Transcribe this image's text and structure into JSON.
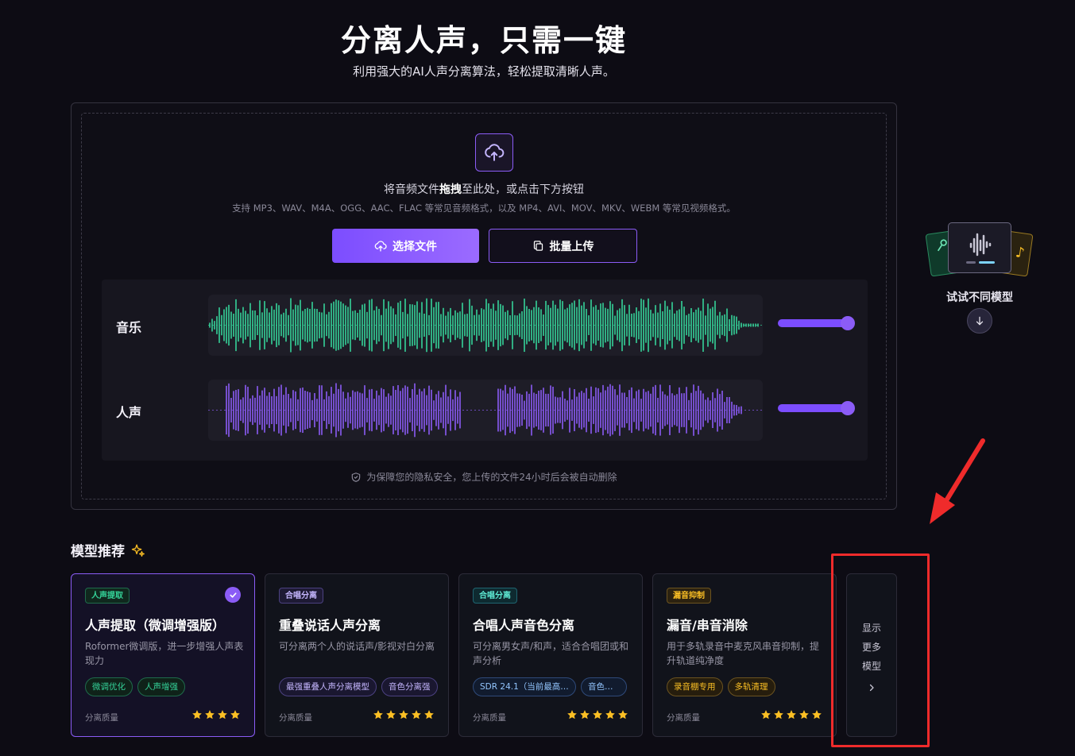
{
  "hero": {
    "title": "分离人声，只需一键",
    "subtitle": "利用强大的AI人声分离算法，轻松提取清晰人声。"
  },
  "upload": {
    "drag_text_before": "将音频文件",
    "drag_text_bold": "拖拽",
    "drag_text_after": "至此处，或点击下方按钮",
    "formats": "支持 MP3、WAV、M4A、OGG、AAC、FLAC 等常见音频格式，以及 MP4、AVI、MOV、MKV、WEBM 等常见视频格式。",
    "choose_file_label": "选择文件",
    "batch_upload_label": "批量上传",
    "privacy_text": "为保障您的隐私安全，您上传的文件24小时后会被自动删除",
    "tracks": [
      {
        "label": "音乐",
        "color": "#34d399",
        "volume": 1.0
      },
      {
        "label": "人声",
        "color": "#8b5cf6",
        "volume": 1.0
      }
    ]
  },
  "try_widget": {
    "label": "试试不同模型"
  },
  "models": {
    "section_title": "模型推荐",
    "cards": [
      {
        "tag": "人声提取",
        "tag_style": "green",
        "selected": true,
        "title": "人声提取（微调增强版）",
        "description": "Roformer微调版，进一步增强人声表现力",
        "chips": [
          {
            "label": "微调优化",
            "style": "green"
          },
          {
            "label": "人声增强",
            "style": "green"
          }
        ],
        "quality_label": "分离质量",
        "stars": 4
      },
      {
        "tag": "合唱分离",
        "tag_style": "purple",
        "selected": false,
        "title": "重叠说话人声分离",
        "description": "可分离两个人的说话声/影视对白分离",
        "chips": [
          {
            "label": "最强重叠人声分离模型",
            "style": "purple"
          },
          {
            "label": "音色分离强",
            "style": "purple"
          }
        ],
        "quality_label": "分离质量",
        "stars": 5
      },
      {
        "tag": "合唱分离",
        "tag_style": "teal",
        "selected": false,
        "title": "合唱人声音色分离",
        "description": "可分离男女声/和声，适合合唱团或和声分析",
        "chips": [
          {
            "label": "SDR 24.1（当前最高之...",
            "style": "blue"
          },
          {
            "label": "音色分...",
            "style": "blue"
          }
        ],
        "quality_label": "分离质量",
        "stars": 5
      },
      {
        "tag": "漏音抑制",
        "tag_style": "amber",
        "selected": false,
        "title": "漏音/串音消除",
        "description": "用于多轨录音中麦克风串音抑制，提升轨道纯净度",
        "chips": [
          {
            "label": "录音棚专用",
            "style": "amber"
          },
          {
            "label": "多轨清理",
            "style": "amber"
          }
        ],
        "quality_label": "分离质量",
        "stars": 5
      }
    ],
    "more": {
      "line1": "显示",
      "line2": "更多",
      "line3": "模型"
    }
  },
  "colors": {
    "accent": "#8b5cf6",
    "music_wave": "#34d399",
    "vocal_wave": "#8b5cf6",
    "star": "#fbbf24",
    "highlight": "#ef2b2b"
  }
}
